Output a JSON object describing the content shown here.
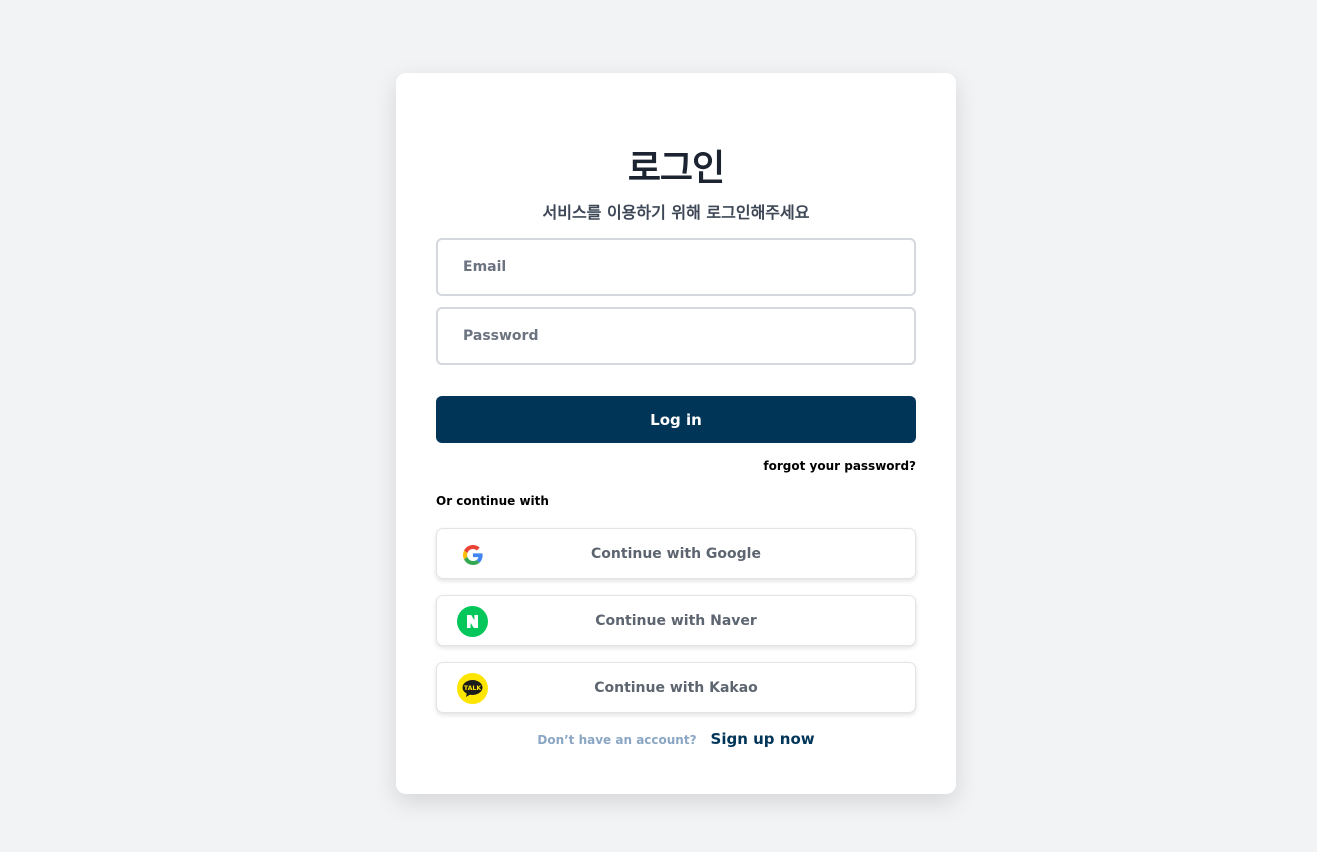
{
  "login": {
    "title": "로그인",
    "subtitle": "서비스를 이용하기 위해 로그인해주세요",
    "email_placeholder": "Email",
    "password_placeholder": "Password",
    "login_button": "Log in",
    "forgot_password": "forgot your password?",
    "or_continue": "Or continue with",
    "social": {
      "google": "Continue with Google",
      "naver": "Continue with Naver",
      "kakao": "Continue with Kakao"
    },
    "no_account": "Don’t have an account?",
    "signup": "Sign up now"
  },
  "icons": {
    "google": "google-g-icon",
    "naver": "naver-n-icon",
    "kakao": "kakao-talk-icon",
    "kakao_icon_text": "TALK"
  },
  "colors": {
    "primary": "#003558",
    "naver_green": "#03c75a",
    "kakao_yellow": "#fee500"
  }
}
